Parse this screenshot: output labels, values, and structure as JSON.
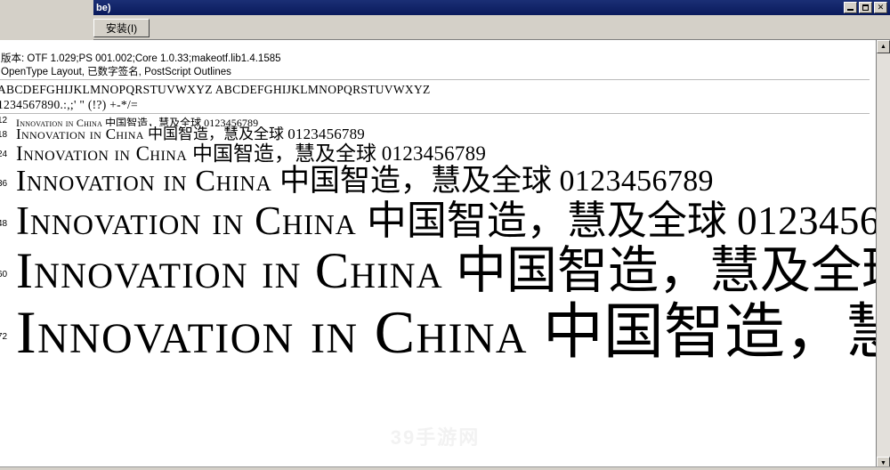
{
  "window": {
    "title_fragment": "be)",
    "controls": {
      "minimize_label": "Minimize",
      "maximize_label": "Maximize",
      "close_label": "✕"
    }
  },
  "toolbar": {
    "install_label": "安装(I)"
  },
  "info": {
    "version_line": "版本: OTF 1.029;PS 001.002;Core 1.0.33;makeotf.lib1.4.1585",
    "features_line": "OpenType Layout, 已数字签名, PostScript Outlines"
  },
  "alphabet": {
    "letters_line": "ABCDEFGHIJKLMNOPQRSTUVWXYZ ABCDEFGHIJKLMNOPQRSTUVWXYZ",
    "symbols_line": "1234567890.:,;' \" (!?) +-*/="
  },
  "specimen": {
    "latin": "Innovation in China",
    "cjk": "中国智造，慧及全球",
    "numerals": "0123456789",
    "rows": [
      {
        "size": "12"
      },
      {
        "size": "18"
      },
      {
        "size": "24"
      },
      {
        "size": "36"
      },
      {
        "size": "48"
      },
      {
        "size": "60"
      },
      {
        "size": "72"
      }
    ]
  },
  "watermark": {
    "text": "39手游网"
  },
  "scrollbar": {
    "up_arrow": "▲",
    "down_arrow": "▼"
  },
  "colors": {
    "titlebar": "#0a1a5c",
    "chrome": "#d4d0c8",
    "page": "#ffffff",
    "rule": "#b9b9b9"
  }
}
